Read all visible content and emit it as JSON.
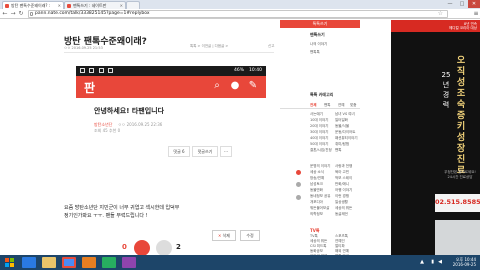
{
  "browser": {
    "tabs": [
      {
        "label": "방탄 팬톡수준왜이래? :",
        "active": true
      },
      {
        "label": "팬톡쓰기 : 네이트판",
        "active": false
      },
      {
        "label": "",
        "active": false
      }
    ],
    "url": "pann.nate.com/talk/333825145?page=1#replybox",
    "min": "—",
    "max": "□",
    "close": "✕",
    "back": "←",
    "forward": "→",
    "reload": "↻",
    "star": "☆",
    "menu": "≡"
  },
  "article": {
    "title": "방탄 팬톡수준왜이래?",
    "meta": "ㅇㅇ  2016.09.25 21:53",
    "meta_right": "톡톡 > 이전글 | 다음글 >",
    "meta_right2": "신고",
    "phone": {
      "time": "10:40",
      "status_pct": "46%",
      "logo": "판",
      "greeting": "안녕하세요! 타팬입니다",
      "author": "방탄소년단",
      "author_date": "ㅇㅇ  2016.09.25 22:36",
      "views": "조회 45  추천 0",
      "reply_btn": "댓글 6",
      "reply_write": "댓글쓰기",
      "more": "···"
    },
    "body": "요즘 방탄소년단 지민군이 너무 귀엽고 섹시한데 입덕부\n정기인가봐요 ㅜㅜ. 팬들 부럭드립니다 !",
    "delete_btn": "삭제",
    "edit_btn": "수정",
    "delete_x": "✕"
  },
  "reactions": {
    "left_count": "0",
    "right_count": "2"
  },
  "sidebar": {
    "header": "톡톡쓰기",
    "my_section": "팬톡쓰기",
    "my_items": [
      "나의 이야기",
      "팬톡톡"
    ],
    "cat_title": "톡톡 카테고리",
    "cat_tabs": [
      "전체",
      "팬톡",
      "연예",
      "맞춤"
    ],
    "cat_tab_on": 0,
    "col1": [
      "사는얘기",
      "10대 이야기",
      "20대 이야기",
      "30대 이야기",
      "40대 이야기",
      "50대 이야기",
      "결혼/시집/친정"
    ],
    "col2": [
      "남녀 VS 여녀",
      "일터일화",
      "동물/식물",
      "운동/다이어트",
      "패션뷰티이야기",
      "취미/탐험",
      "팬톡"
    ],
    "col3_title": "",
    "col3a": [
      "운명의 이야기",
      "세상 소식",
      "방송/연예",
      "남성토크",
      "동물만화",
      "동네정보 공유",
      "개포디아",
      "뭐든물어보살",
      "의학정보"
    ],
    "col3b": [
      "사랑과 전쟁",
      "육아 고민",
      "먹보 스테이",
      "만화/애니",
      "어행 이야기",
      "이런 경쟁",
      "일상생활",
      "세상의 뭐든",
      "동글제언"
    ],
    "col4_title": "TV톡",
    "col4a": [
      "TV톡",
      "세상의 뭐든",
      "CSI 미드톡",
      "동화공보",
      "이야기 연재",
      "무서운 일이야",
      "영광방송마 이야기"
    ],
    "col4b": [
      "스포츠톡",
      "연예인",
      "얼티파",
      "해외 연예",
      "팬톡 안내",
      "동물을 나쁜",
      ""
    ]
  },
  "ad": {
    "top_text": "8년 연속\n헤디컬 코리아 대상",
    "years": "25년경력",
    "main": "오직성조숙증키성장진료",
    "sub": "우정단된 올바르세요!\n24시간 진료상담",
    "phone": "02.515.8585"
  },
  "taskbar": {
    "time": "오후 10:44",
    "date": "2016-09-25",
    "icons": [
      "ie",
      "folder",
      "chrome",
      "media",
      "chat",
      "photo"
    ]
  },
  "colors": {
    "accent": "#e8473a",
    "taskbar": "#1d4569",
    "ad_gold": "#f1d27a"
  }
}
